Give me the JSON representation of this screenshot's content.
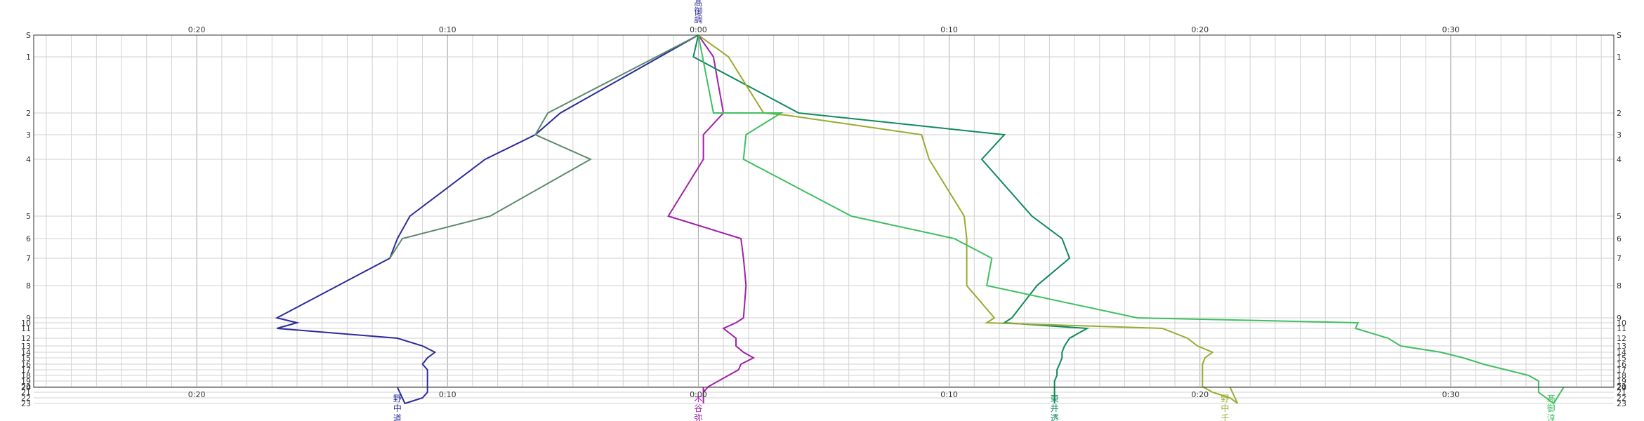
{
  "chart_data": {
    "type": "line",
    "x_tick_labels": [
      {
        "t": -20,
        "label": "0:20"
      },
      {
        "t": -10,
        "label": "0:10"
      },
      {
        "t": 0,
        "label": "0:00"
      },
      {
        "t": 10,
        "label": "0:10"
      },
      {
        "t": 20,
        "label": "0:20"
      },
      {
        "t": 30,
        "label": "0:30"
      }
    ],
    "xlim": [
      -26.5,
      36.5
    ],
    "ylim": [
      0,
      24
    ],
    "station_ticks": [
      {
        "pos": 0,
        "label": "S"
      },
      {
        "pos": 1,
        "label": "1"
      },
      {
        "pos": 2,
        "label": "2"
      },
      {
        "pos": 3,
        "label": "3"
      },
      {
        "pos": 4,
        "label": "4"
      },
      {
        "pos": 5,
        "label": "5"
      },
      {
        "pos": 6,
        "label": "6"
      },
      {
        "pos": 7,
        "label": "7"
      },
      {
        "pos": 8,
        "label": "8"
      },
      {
        "pos": 9,
        "label": "9"
      },
      {
        "pos": 10,
        "label": "10"
      },
      {
        "pos": 11,
        "label": "11"
      },
      {
        "pos": 12,
        "label": "12"
      },
      {
        "pos": 13,
        "label": "13"
      },
      {
        "pos": 14,
        "label": "14"
      },
      {
        "pos": 15,
        "label": "15"
      },
      {
        "pos": 16,
        "label": "16"
      },
      {
        "pos": 17,
        "label": "17"
      },
      {
        "pos": 18,
        "label": "18"
      },
      {
        "pos": 19,
        "label": "19"
      },
      {
        "pos": 20,
        "label": "20"
      },
      {
        "pos": 21,
        "label": "21"
      },
      {
        "pos": 22,
        "label": "22"
      },
      {
        "pos": 23,
        "label": "23"
      },
      {
        "pos": 24,
        "label": "24"
      }
    ],
    "top_series_label": "髙御調",
    "series": [
      {
        "name": "野中道",
        "color": "#2b2b9a",
        "label_t": -12,
        "points": [
          [
            0,
            0
          ],
          [
            -5.5,
            2
          ],
          [
            -6.5,
            3
          ],
          [
            -8.5,
            4
          ],
          [
            -11.5,
            5
          ],
          [
            -12,
            6
          ],
          [
            -12.3,
            7
          ],
          [
            -16.8,
            9
          ],
          [
            -16,
            10
          ],
          [
            -16.8,
            11
          ],
          [
            -12,
            12
          ],
          [
            -11,
            13
          ],
          [
            -10.5,
            14
          ],
          [
            -10.8,
            15
          ],
          [
            -11,
            16
          ],
          [
            -10.8,
            17
          ],
          [
            -10.8,
            18
          ],
          [
            -10.8,
            19
          ],
          [
            -10.8,
            20
          ],
          [
            -10.8,
            21
          ],
          [
            -11,
            22
          ],
          [
            -11.7,
            23
          ],
          [
            -12,
            24
          ]
        ]
      },
      {
        "name": "",
        "color": "#5b8a6a",
        "points": [
          [
            0,
            0
          ],
          [
            -6,
            2
          ],
          [
            -6.5,
            3
          ],
          [
            -4.3,
            4
          ],
          [
            -8.3,
            5
          ],
          [
            -11.8,
            6
          ],
          [
            -12.3,
            7
          ]
        ]
      },
      {
        "name": "木谷弥",
        "color": "#a020a8",
        "label_t": 0,
        "points": [
          [
            0,
            0
          ],
          [
            0.6,
            1
          ],
          [
            1,
            2
          ],
          [
            0.2,
            3
          ],
          [
            0.2,
            4
          ],
          [
            -1.2,
            5
          ],
          [
            1.7,
            6
          ],
          [
            1.8,
            7
          ],
          [
            1.9,
            8
          ],
          [
            1.8,
            9
          ],
          [
            1.5,
            10
          ],
          [
            1,
            11
          ],
          [
            1.5,
            12
          ],
          [
            1.5,
            13
          ],
          [
            1.8,
            14
          ],
          [
            2.2,
            15
          ],
          [
            1.7,
            16
          ],
          [
            1.6,
            17
          ],
          [
            1.2,
            18
          ],
          [
            0.8,
            19
          ],
          [
            0.4,
            20
          ],
          [
            0.2,
            21
          ],
          [
            0.2,
            22
          ],
          [
            0.2,
            23
          ],
          [
            0.2,
            24
          ]
        ]
      },
      {
        "name": "東井透",
        "color": "#0f8a5a",
        "label_t": 14.2,
        "points": [
          [
            0,
            0
          ],
          [
            -0.2,
            1
          ],
          [
            4,
            2
          ],
          [
            12.2,
            3
          ],
          [
            11.3,
            4
          ],
          [
            13.3,
            5
          ],
          [
            14.5,
            6
          ],
          [
            14.8,
            7
          ],
          [
            13.5,
            8
          ],
          [
            12.5,
            9
          ],
          [
            12.2,
            10
          ],
          [
            15.5,
            11
          ],
          [
            14.8,
            12
          ],
          [
            14.6,
            13
          ],
          [
            14.5,
            14
          ],
          [
            14.5,
            15
          ],
          [
            14.4,
            16
          ],
          [
            14.3,
            17
          ],
          [
            14.3,
            18
          ],
          [
            14.2,
            19
          ],
          [
            14.2,
            20
          ],
          [
            14.2,
            21
          ],
          [
            14.2,
            22
          ],
          [
            14.2,
            23
          ],
          [
            14.2,
            24
          ]
        ]
      },
      {
        "name": "野中千",
        "color": "#9aaa30",
        "label_t": 21,
        "points": [
          [
            0,
            0
          ],
          [
            1.2,
            1
          ],
          [
            2.6,
            2
          ],
          [
            3.5,
            2.1
          ],
          [
            8.9,
            3
          ],
          [
            9.2,
            4
          ],
          [
            10.6,
            5
          ],
          [
            10.7,
            6
          ],
          [
            10.7,
            7
          ],
          [
            10.7,
            8
          ],
          [
            11.8,
            9
          ],
          [
            11.5,
            10
          ],
          [
            18.5,
            11
          ],
          [
            19.5,
            12
          ],
          [
            19.9,
            13
          ],
          [
            20.5,
            14
          ],
          [
            20.2,
            15
          ],
          [
            20.1,
            16
          ],
          [
            20.1,
            17
          ],
          [
            20.1,
            18
          ],
          [
            20.1,
            19
          ],
          [
            20.1,
            20
          ],
          [
            20.5,
            21
          ],
          [
            21.2,
            22
          ],
          [
            21.5,
            23
          ],
          [
            21.2,
            24
          ]
        ]
      },
      {
        "name": "髙御淳",
        "color": "#3fbf60",
        "label_t": 34,
        "points": [
          [
            0,
            0
          ],
          [
            0.6,
            2
          ],
          [
            3.3,
            2
          ],
          [
            1.9,
            3
          ],
          [
            1.8,
            4
          ],
          [
            6.1,
            5
          ],
          [
            10.2,
            6
          ],
          [
            11.7,
            7
          ],
          [
            11.5,
            8
          ],
          [
            17.5,
            9
          ],
          [
            26.3,
            10
          ],
          [
            26.2,
            11
          ],
          [
            27.5,
            12
          ],
          [
            28,
            13
          ],
          [
            29.6,
            14
          ],
          [
            30.5,
            15
          ],
          [
            31.3,
            16
          ],
          [
            32.2,
            17
          ],
          [
            33.1,
            18
          ],
          [
            33.5,
            19
          ],
          [
            33.5,
            20
          ],
          [
            33.5,
            21
          ],
          [
            33.8,
            22
          ],
          [
            34.1,
            23
          ],
          [
            34.5,
            24
          ]
        ]
      }
    ]
  },
  "colors": {
    "grid": "#d2d2d2",
    "grid_major": "#a8a8a8",
    "axis": "#303030",
    "text": "#333333"
  }
}
